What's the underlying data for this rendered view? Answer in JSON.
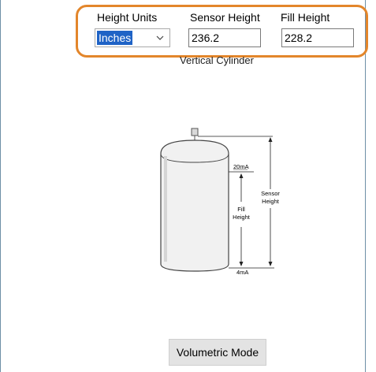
{
  "header": {
    "height_units_label": "Height Units",
    "sensor_height_label": "Sensor Height",
    "fill_height_label": "Fill Height"
  },
  "height_units": {
    "selected": "Inches"
  },
  "sensor_height": {
    "value": "236.2"
  },
  "fill_height": {
    "value": "228.2"
  },
  "subtitle": "Vertical Cylinder",
  "diagram": {
    "top_label": "20mA",
    "bottom_label": "4mA",
    "fill_label_line1": "Fill",
    "fill_label_line2": "Height",
    "sensor_label_line1": "Sensor",
    "sensor_label_line2": "Height"
  },
  "buttons": {
    "volumetric_mode": "Volumetric Mode"
  },
  "colors": {
    "highlight": "#e3862b",
    "selection": "#1f63c6",
    "frame": "#6e8fa6"
  },
  "icons": {
    "dropdown": "chevron-down-icon"
  }
}
